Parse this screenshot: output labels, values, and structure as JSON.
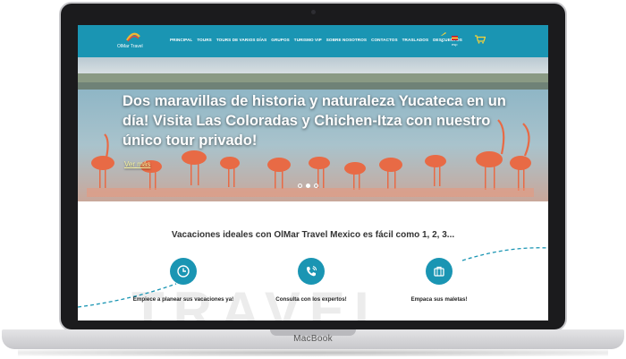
{
  "device": {
    "label": "MacBook"
  },
  "site": {
    "logo_text": "OlMar Travel",
    "menu": [
      "PRINCIPAL",
      "TOURS",
      "TOURS DE VARIOS DÍAS",
      "GRUPOS",
      "TURISMO VIP",
      "SOBRE NOSOTROS",
      "CONTACTOS",
      "TRASLADOS",
      "DESCUENTOS"
    ],
    "language": "esp",
    "colors": {
      "brand": "#1a95b3",
      "more_link": "#f6f3a0"
    }
  },
  "hero": {
    "title": "Dos maravillas de historia y naturaleza Yucateca en un día! Visita Las Coloradas y Chichen-Itza con nuestro único tour privado!",
    "more_label": "Ver más",
    "slides_total": 3,
    "slide_active": 1
  },
  "intro": {
    "tagline": "Vacaciones ideales con OlMar Travel Mexico es fácil como 1, 2, 3...",
    "watermark": "TRAVEL",
    "steps": [
      {
        "icon": "clock-icon",
        "label": "Empiece a planear sus vacaciones ya!"
      },
      {
        "icon": "phone-icon",
        "label": "Consulta con los expertos!"
      },
      {
        "icon": "suitcase-icon",
        "label": "Empaca sus maletas!"
      }
    ]
  }
}
